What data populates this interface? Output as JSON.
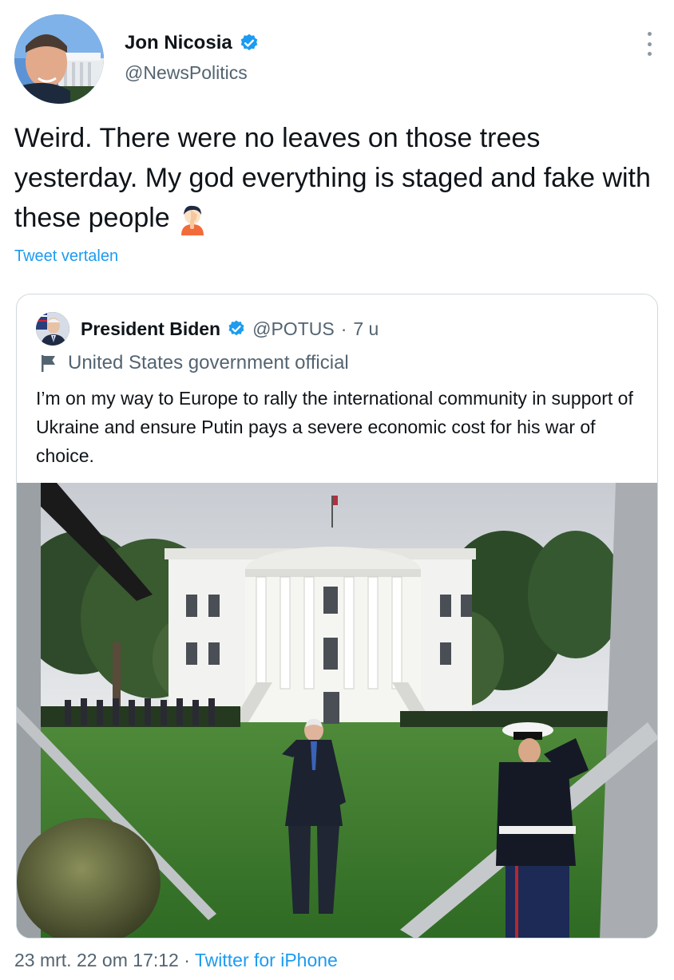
{
  "author": {
    "name": "Jon Nicosia",
    "handle": "@NewsPolitics",
    "verified_icon": "verified-badge-icon",
    "accent_color": "#1d9bf0"
  },
  "tweet": {
    "text": "Weird.  There were no leaves on those trees yesterday. My god everything is staged and fake with these people",
    "emoji_icon": "person-facepalming-icon",
    "translate_label": "Tweet vertalen"
  },
  "quoted": {
    "name": "President Biden",
    "handle": "@POTUS",
    "separator": "·",
    "time": "7 u",
    "label": "United States government official",
    "label_icon": "flag-icon",
    "text": "I’m on my way to Europe to rally the international community in support of Ukraine and ensure Putin pays a severe economic cost for his war of choice.",
    "image_icon": "white-house-photo"
  },
  "meta": {
    "timestamp": "23 mrt. 22 om 17:12",
    "separator": " · ",
    "source": "Twitter for iPhone"
  },
  "more_menu_icon": "more-options-icon"
}
